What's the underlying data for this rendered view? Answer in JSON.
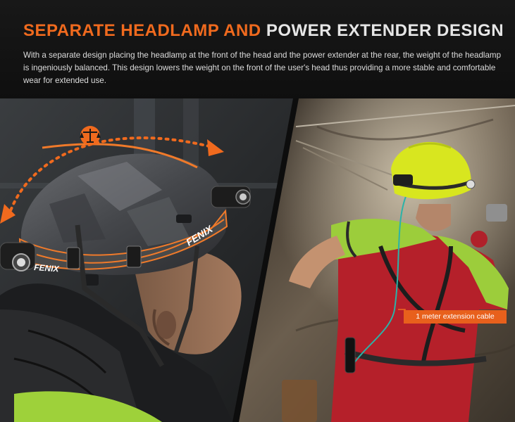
{
  "header": {
    "title_accent": "SEPARATE HEADLAMP AND",
    "title_plain": "POWER EXTENDER DESIGN",
    "description": "With a separate design placing the headlamp at the front of the head and the power extender at the rear, the weight of the headlamp is ingeniously balanced. This design lowers the weight on the front of the user's head thus providing a more stable and comfortable wear for extended use."
  },
  "photo_left": {
    "strap_brand_front": "FENIX",
    "strap_brand_rear": "FENIX",
    "balance_icon": "scale-icon"
  },
  "photo_right": {
    "callout_label": "1 meter extension cable"
  },
  "colors": {
    "accent": "#f06a1e",
    "callout_bg": "#e8601c",
    "background": "#0d0d0d"
  }
}
